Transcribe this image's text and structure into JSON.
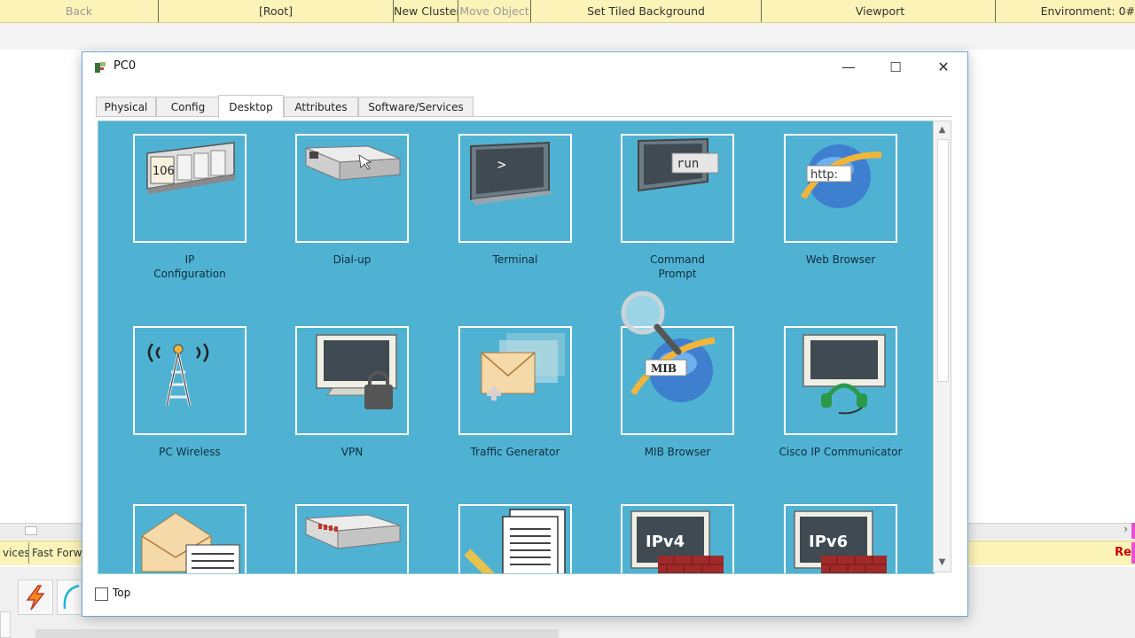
{
  "toolbar": {
    "back": "Back",
    "root": "[Root]",
    "new_cluster": "New Cluster",
    "move_object": "Move Object",
    "set_tiled_background": "Set Tiled Background",
    "viewport": "Viewport",
    "environment": "Environment: 0#"
  },
  "window": {
    "title": "PC0",
    "controls": {
      "minimize": "—",
      "maximize": "☐",
      "close": "✕"
    },
    "tabs": [
      {
        "label": "Physical"
      },
      {
        "label": "Config"
      },
      {
        "label": "Desktop",
        "active": true
      },
      {
        "label": "Attributes"
      },
      {
        "label": "Software/Services"
      }
    ],
    "footer": {
      "top_label": "Top",
      "top_checked": false
    },
    "desktop_bg": "#4fb2d3",
    "apps": [
      {
        "label": "IP\nConfiguration",
        "icon": "ip-config-icon"
      },
      {
        "label": "Dial-up",
        "icon": "modem-icon"
      },
      {
        "label": "Terminal",
        "icon": "terminal-icon",
        "glyph": ">"
      },
      {
        "label": "Command\nPrompt",
        "icon": "command-prompt-icon",
        "glyph": "run"
      },
      {
        "label": "Web Browser",
        "icon": "web-browser-icon",
        "glyph": "http:"
      },
      {
        "label": "PC Wireless",
        "icon": "wireless-tower-icon"
      },
      {
        "label": "VPN",
        "icon": "vpn-lock-icon"
      },
      {
        "label": "Traffic Generator",
        "icon": "traffic-generator-icon"
      },
      {
        "label": "MIB Browser",
        "icon": "mib-browser-icon",
        "glyph": "MIB"
      },
      {
        "label": "Cisco IP Communicator",
        "icon": "ip-communicator-icon"
      },
      {
        "label": "",
        "icon": "email-icon"
      },
      {
        "label": "",
        "icon": "router-device-icon"
      },
      {
        "label": "",
        "icon": "text-editor-icon"
      },
      {
        "label": "",
        "icon": "ipv4-firewall-icon",
        "glyph": "IPv4"
      },
      {
        "label": "",
        "icon": "ipv6-firewall-icon",
        "glyph": "IPv6"
      }
    ]
  },
  "background": {
    "strip_left_1": "vices",
    "strip_left_2": "Fast Forw",
    "strip_right": "Re"
  },
  "colors": {
    "toolbar_bg": "#fbf3b7",
    "desktop_bg": "#4fb2d3",
    "accent_pink": "#e84fd6"
  }
}
